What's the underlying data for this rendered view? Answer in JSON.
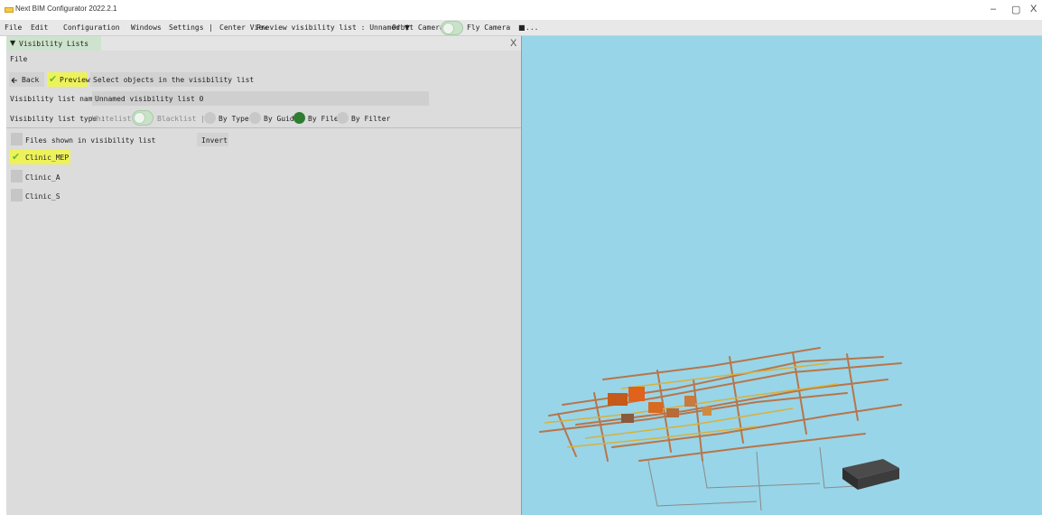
{
  "window": {
    "title": "Next BIM Configurator 2022.2.1",
    "controls": {
      "minimize": "–",
      "maximize": "▢",
      "close": "X"
    }
  },
  "menubar": {
    "items": [
      "File",
      "Edit",
      "Configuration",
      "Windows",
      "Settings"
    ],
    "separator": "|",
    "center_view": "Center View",
    "preview_list": "Preview visibility list : Unnamed",
    "preview_caret": "▼",
    "orbit_camera": "Orbit Camera",
    "fly_camera": "Fly Camera",
    "fly_icon": "■",
    "more": "..."
  },
  "panel": {
    "tab_title": "Visibility Lists",
    "tab_icon": "▼",
    "close": "X",
    "menu_file": "File",
    "back_label": "Back",
    "back_icon": "🡰",
    "preview_label": "Preview",
    "preview_tick": "✔",
    "select_label": "Select objects in the visibility list",
    "name_label": "Visibility list name :",
    "name_value": "Unnamed visibility list 0",
    "type_label": "Visibility list type :",
    "whitelist": "Whitelist",
    "blacklist": "Blacklist |",
    "by_type": "By Type",
    "by_guid": "By Guid",
    "by_file": "By File",
    "by_filter": "By Filter",
    "files_header": "Files shown in visibility list",
    "invert": "Invert",
    "files": [
      {
        "name": "Clinic_MEP",
        "checked": true
      },
      {
        "name": "Clinic_A",
        "checked": false
      },
      {
        "name": "Clinic_S",
        "checked": false
      }
    ]
  },
  "colors": {
    "viewport_bg": "#98d5e8",
    "highlight": "#eef25a",
    "toggle_green": "#c8e2c8",
    "radio_selected": "#2e7d32",
    "check_green": "#5fbf2a",
    "pipe_copper": "#b8754a"
  }
}
